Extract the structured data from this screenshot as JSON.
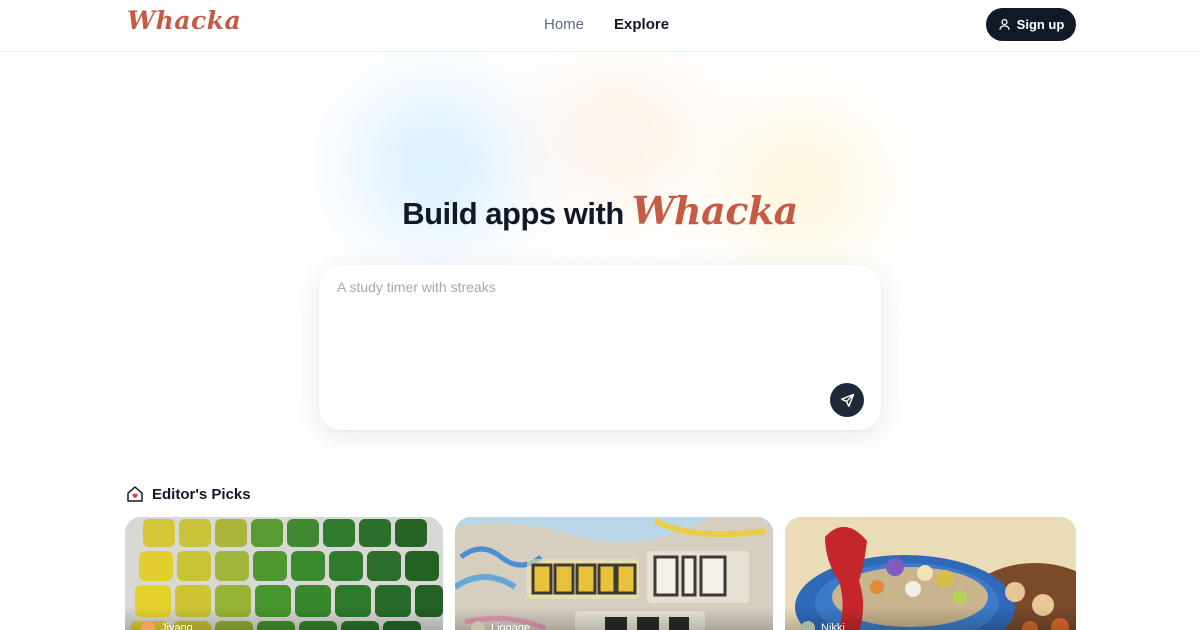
{
  "header": {
    "logo": "Whacka",
    "nav": [
      {
        "label": "Home"
      },
      {
        "label": "Explore"
      }
    ],
    "signup_label": "Sign up"
  },
  "hero": {
    "title_prefix": "Build apps with",
    "title_brand": "Whacka"
  },
  "prompt": {
    "placeholder": "A study timer with streaks",
    "value": ""
  },
  "picks": {
    "title": "Editor's Picks",
    "cards": [
      {
        "author": "Jiyang",
        "icon": "cubes-image"
      },
      {
        "author": "Liggage",
        "icon": "dream-big-image"
      },
      {
        "author": "Nikki",
        "icon": "crochet-basket-image"
      }
    ]
  },
  "colors": {
    "brand": "#c45c45",
    "dark": "#111827",
    "muted": "#5b6b82"
  }
}
